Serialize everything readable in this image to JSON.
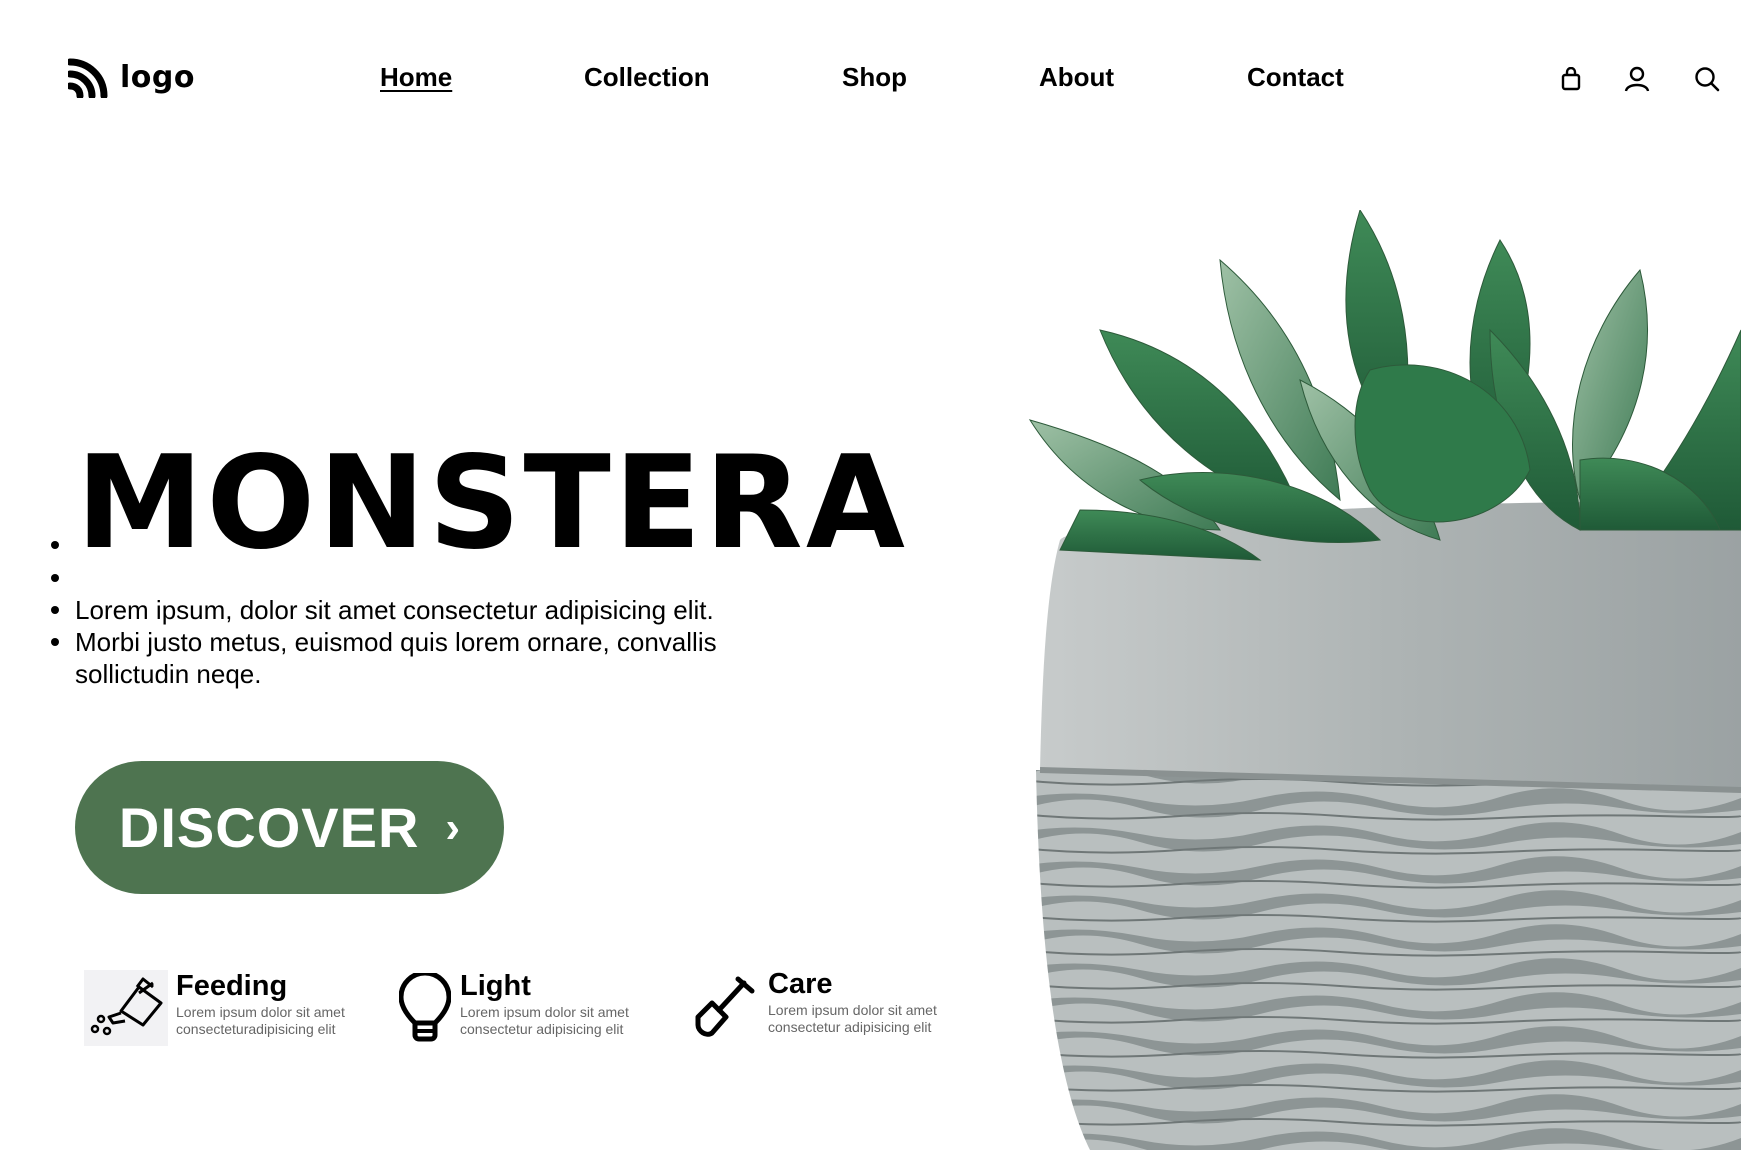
{
  "header": {
    "logo_text": "logo",
    "nav": [
      {
        "label": "Home",
        "active": true
      },
      {
        "label": "Collection",
        "active": false
      },
      {
        "label": "Shop",
        "active": false
      },
      {
        "label": "About",
        "active": false
      },
      {
        "label": "Contact",
        "active": false
      }
    ],
    "icons": [
      "shopping-bag-icon",
      "user-icon",
      "search-icon"
    ]
  },
  "hero": {
    "title": "MONSTERA",
    "lines": [
      "Lorem ipsum, dolor sit amet consectetur adipisicing elit.",
      "Morbi justo metus, euismod quis lorem ornare, convallis sollictudin neqe."
    ],
    "cta_label": "DISCOVER",
    "cta_arrow": "›",
    "cta_color": "#4e7450"
  },
  "features": [
    {
      "title": "Feeding",
      "desc_1": "Lorem ipsum dolor sit amet",
      "desc_2": "consecteturadipisicing elit",
      "icon": "watering-can-icon"
    },
    {
      "title": "Light",
      "desc_1": "Lorem ipsum dolor sit amet",
      "desc_2": "consectetur adipisicing elit",
      "icon": "light-bulb-icon"
    },
    {
      "title": "Care",
      "desc_1": "Lorem ipsum dolor sit amet",
      "desc_2": "consectetur adipisicing elit",
      "icon": "shovel-icon"
    }
  ]
}
